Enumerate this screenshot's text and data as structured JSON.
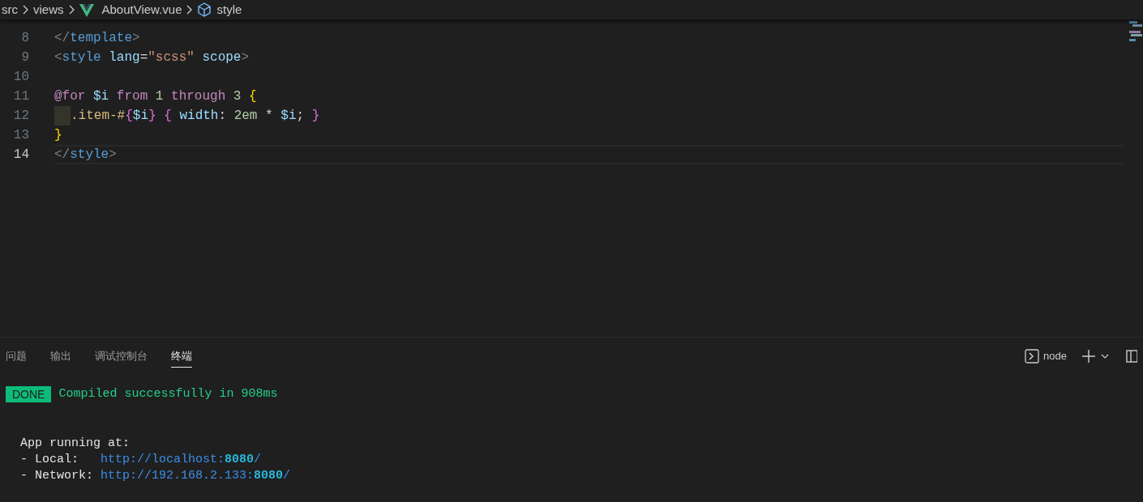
{
  "breadcrumb": [
    {
      "kind": "folder",
      "label": "src"
    },
    {
      "kind": "folder",
      "label": "views"
    },
    {
      "kind": "vue",
      "label": "AboutView.vue"
    },
    {
      "kind": "symbol",
      "label": "style"
    }
  ],
  "editor": {
    "lines": [
      {
        "number": "8",
        "current": false,
        "indent": false,
        "tokens": [
          {
            "kind": "punct",
            "text": "</"
          },
          {
            "kind": "tag",
            "text": "template"
          },
          {
            "kind": "punct",
            "text": ">"
          }
        ]
      },
      {
        "number": "9",
        "current": false,
        "indent": false,
        "tokens": [
          {
            "kind": "punct",
            "text": "<"
          },
          {
            "kind": "tag",
            "text": "style"
          },
          {
            "kind": "attr",
            "text": " lang"
          },
          {
            "kind": "plain",
            "text": "="
          },
          {
            "kind": "string",
            "text": "\"scss\""
          },
          {
            "kind": "attr",
            "text": " scope"
          },
          {
            "kind": "punct",
            "text": ">"
          }
        ]
      },
      {
        "number": "10",
        "current": false,
        "indent": false
      },
      {
        "number": "11",
        "current": false,
        "indent": false,
        "tokens": [
          {
            "kind": "keyword",
            "text": "@for"
          },
          {
            "kind": "variable",
            "text": " $i"
          },
          {
            "kind": "keyword",
            "text": " from"
          },
          {
            "kind": "number",
            "text": " 1 "
          },
          {
            "kind": "keyword",
            "text": "through"
          },
          {
            "kind": "number",
            "text": " 3 "
          },
          {
            "kind": "bracket1",
            "text": "{"
          }
        ]
      },
      {
        "number": "12",
        "current": false,
        "indent": true,
        "tokens": [
          {
            "kind": "selector",
            "text": ".item-#"
          },
          {
            "kind": "bracket2",
            "text": "{"
          },
          {
            "kind": "variable",
            "text": "$i"
          },
          {
            "kind": "bracket2",
            "text": "}"
          },
          {
            "kind": "bracket2",
            "text": " {"
          },
          {
            "kind": "variable",
            "text": " width"
          },
          {
            "kind": "plain",
            "text": ": "
          },
          {
            "kind": "number",
            "text": "2em"
          },
          {
            "kind": "plain",
            "text": " * "
          },
          {
            "kind": "variable",
            "text": "$i"
          },
          {
            "kind": "plain",
            "text": "; "
          },
          {
            "kind": "bracket2",
            "text": "}"
          }
        ]
      },
      {
        "number": "13",
        "current": false,
        "indent": false,
        "tokens": [
          {
            "kind": "bracket1",
            "text": "}"
          }
        ]
      },
      {
        "number": "14",
        "current": true,
        "indent": false,
        "tokens": [
          {
            "kind": "punct",
            "text": "</"
          },
          {
            "kind": "tag",
            "text": "style"
          },
          {
            "kind": "punct",
            "text": ">"
          }
        ]
      }
    ]
  },
  "panel": {
    "tabs": [
      {
        "label": "问题",
        "selected": false
      },
      {
        "label": "输出",
        "selected": false
      },
      {
        "label": "调试控制台",
        "selected": false
      },
      {
        "label": "终端",
        "selected": true
      }
    ],
    "terminal_name": "node",
    "terminal": [
      {
        "kind": "status",
        "badge": "DONE",
        "text": "Compiled successfully in 908ms"
      },
      {
        "kind": "text",
        "text": "App running at:"
      },
      {
        "kind": "url",
        "label": "- Local:   ",
        "url": "http://localhost:",
        "port": "8080",
        "tail": "/"
      },
      {
        "kind": "url",
        "label": "- Network: ",
        "url": "http://192.168.2.133:",
        "port": "8080",
        "tail": "/"
      }
    ]
  }
}
